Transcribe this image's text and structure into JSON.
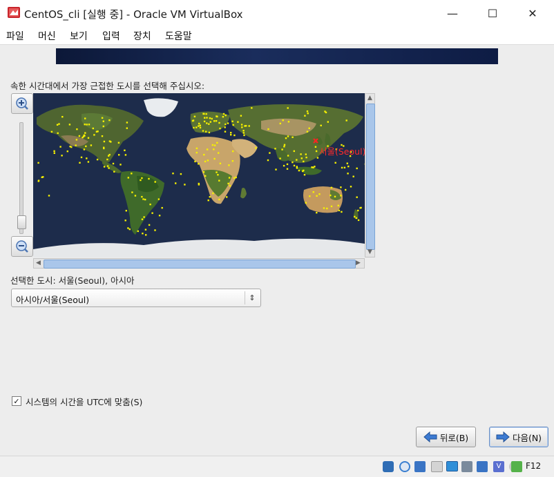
{
  "window": {
    "title": "CentOS_cli [실행 중] - Oracle VM VirtualBox",
    "controls": {
      "minimize": "—",
      "maximize": "☐",
      "close": "✕"
    }
  },
  "menu": [
    "파일",
    "머신",
    "보기",
    "입력",
    "장치",
    "도움말"
  ],
  "timezone": {
    "prompt": "속한 시간대에서 가장 근접한 도시를 선택해 주십시오:",
    "map_marker_label": "서울(Seoul)",
    "selected_city_text": "선택한 도시: 서울(Seoul), 아시아",
    "dropdown_value": "아시아/서울(Seoul)",
    "utc_checkbox_label": "시스템의 시간을 UTC에 맞춤(S)",
    "utc_checked": true
  },
  "buttons": {
    "back": "뒤로(B)",
    "next": "다음(N)"
  },
  "statusbar": {
    "icons": [
      "usb-icon",
      "optical-disc-icon",
      "audio-icon",
      "network-icon",
      "shared-folder-icon",
      "display-icon",
      "capture-icon",
      "cpu-icon",
      "virtualization-icon",
      "mouse-integration-icon",
      "keyboard-capture-icon"
    ],
    "host_key": "F12"
  },
  "colors": {
    "accent": "#2f6db5",
    "banner": "#142550",
    "marker": "#ff2222",
    "city_dot": "#f6f100"
  }
}
